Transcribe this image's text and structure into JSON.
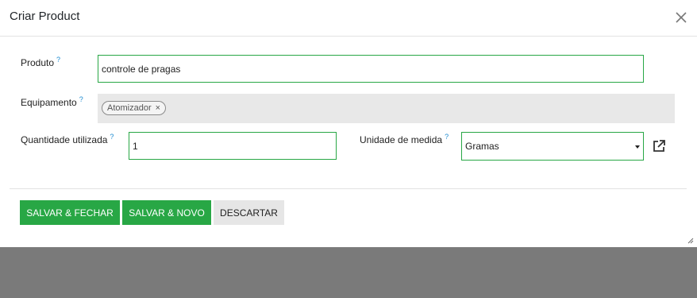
{
  "header": {
    "title": "Criar Product"
  },
  "form": {
    "help_marker": "?",
    "produto": {
      "label": "Produto",
      "value": "controle de pragas"
    },
    "equipamento": {
      "label": "Equipamento",
      "tags": [
        "Atomizador"
      ],
      "tag_remove": "×"
    },
    "quantidade": {
      "label": "Quantidade utilizada",
      "value": "1"
    },
    "unidade": {
      "label": "Unidade de medida",
      "selected": "Gramas"
    }
  },
  "footer": {
    "save_close": "SALVAR & FECHAR",
    "save_new": "SALVAR & NOVO",
    "discard": "DESCARTAR"
  },
  "colors": {
    "primary": "#28a745",
    "help": "#1d8bd1",
    "overlay": "#7a7a7a",
    "disabled_field": "#e8e8e8"
  },
  "icons": [
    "close-icon",
    "external-link-icon",
    "caret-down-icon",
    "resize-handle-icon",
    "remove-tag-icon"
  ]
}
